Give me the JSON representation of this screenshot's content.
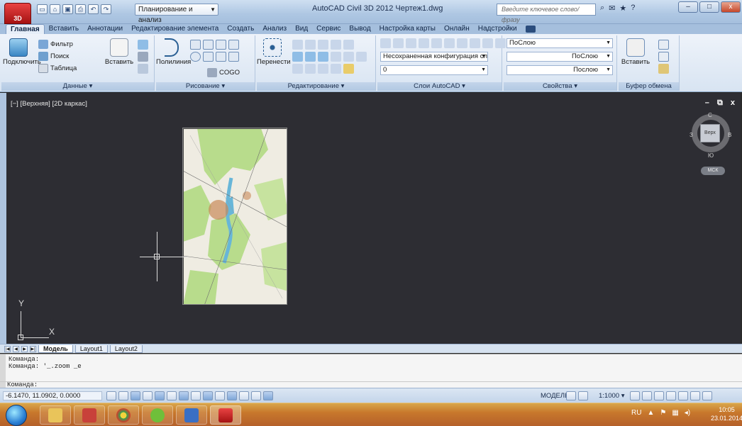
{
  "titlebar": {
    "app_button_label": "3D",
    "workspace": "Планирование и анализ",
    "title": "AutoCAD Civil 3D 2012    Чертеж1.dwg",
    "search_placeholder": "Введите ключевое слово/фразу",
    "qat_icons": [
      "new-file-icon",
      "open-icon",
      "save-icon",
      "print-icon",
      "undo-icon",
      "redo-icon"
    ],
    "window_controls": [
      "–",
      "□",
      "x"
    ]
  },
  "ribbon": {
    "tabs": [
      "Главная",
      "Вставить",
      "Аннотации",
      "Редактирование элемента",
      "Создать",
      "Анализ",
      "Вид",
      "Сервис",
      "Вывод",
      "Настройка карты",
      "Онлайн",
      "Надстройки"
    ],
    "active_tab": "Главная",
    "panels": {
      "data": {
        "title": "Данные ▾",
        "connect": "Подключить",
        "filter": "Фильтр",
        "search": "Поиск",
        "table": "Таблица",
        "insert": "Вставить"
      },
      "draw": {
        "title": "Рисование ▾",
        "polyline": "Полилиния",
        "cogo": "COGO"
      },
      "edit": {
        "title": "Редактирование ▾",
        "move": "Перенести"
      },
      "layers": {
        "title": "Слои AutoCAD ▾",
        "layer_state": "Несохраненная конфигурация сл",
        "layer_current": "0"
      },
      "properties": {
        "title": "Свойства ▾",
        "color": "ПоСлою",
        "lineweight": "ПоСлою",
        "linetype": "Послою"
      },
      "clipboard": {
        "title": "Буфер обмена",
        "paste": "Вставить"
      }
    }
  },
  "viewport": {
    "label": "[−] [Верхняя] [2D каркас]",
    "controls": "– ⧉ x",
    "ucs_y": "Y",
    "ucs_x": "X",
    "viewcube": {
      "north": "С",
      "south": "Ю",
      "east": "В",
      "west": "З",
      "face": "Верх",
      "wcs": "МСК"
    }
  },
  "layout_tabs": [
    "Модель",
    "Layout1",
    "Layout2"
  ],
  "command": {
    "lines": [
      "Команда:",
      "Команда: '_.zoom _e",
      "",
      "Команда:"
    ]
  },
  "status": {
    "coords": "-6.1470, 11.0902, 0.0000",
    "model": "МОДЕЛЬ",
    "scale": "1:1000 ▾"
  },
  "taskbar": {
    "lang": "RU",
    "time": "10:05",
    "date": "23.01.2014"
  },
  "colors": {
    "ribbon_bg": "#dbe6f3",
    "canvas_bg": "#2d2d33",
    "taskbar_bg": "#c8782c",
    "map_green": "#b8dc8c",
    "map_water": "#68b6d8"
  }
}
